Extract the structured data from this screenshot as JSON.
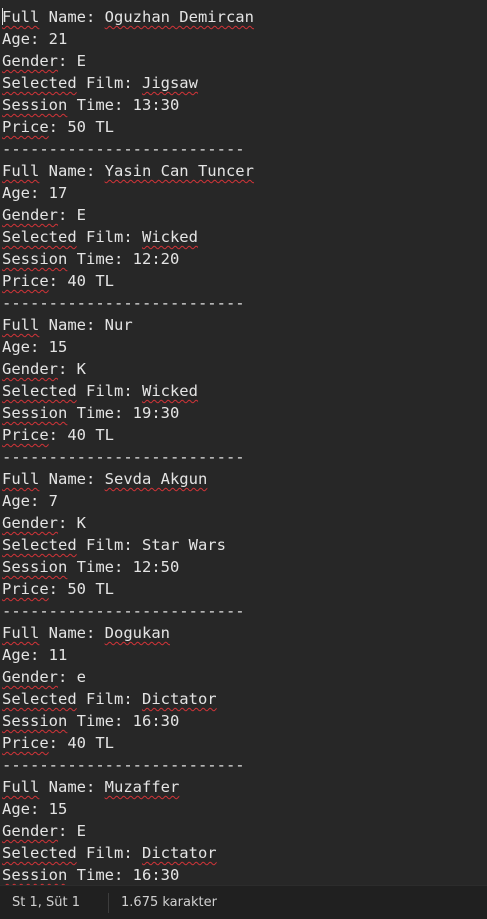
{
  "editor": {
    "lines": [
      {
        "key": "Full",
        "rest": " Name: ",
        "value": "Oguzhan Demircan"
      },
      {
        "key": "Age",
        "rest": ": ",
        "value": "21"
      },
      {
        "key": "Gender",
        "rest": ": ",
        "value": "E"
      },
      {
        "key": "Selected",
        "rest": " Film: ",
        "value": "Jigsaw"
      },
      {
        "key": "Session",
        "rest": " Time: ",
        "value": "13:30"
      },
      {
        "key": "Price",
        "rest": ": ",
        "value": "50 TL"
      },
      {
        "divider": "--------------------------"
      },
      {
        "key": "Full",
        "rest": " Name: ",
        "value": "Yasin Can Tuncer"
      },
      {
        "key": "Age",
        "rest": ": ",
        "value": "17"
      },
      {
        "key": "Gender",
        "rest": ": ",
        "value": "E"
      },
      {
        "key": "Selected",
        "rest": " Film: ",
        "value": "Wicked"
      },
      {
        "key": "Session",
        "rest": " Time: ",
        "value": "12:20"
      },
      {
        "key": "Price",
        "rest": ": ",
        "value": "40 TL"
      },
      {
        "divider": "--------------------------"
      },
      {
        "key": "Full",
        "rest": " Name: ",
        "value": "Nur"
      },
      {
        "key": "Age",
        "rest": ": ",
        "value": "15"
      },
      {
        "key": "Gender",
        "rest": ": ",
        "value": "K"
      },
      {
        "key": "Selected",
        "rest": " Film: ",
        "value": "Wicked"
      },
      {
        "key": "Session",
        "rest": " Time: ",
        "value": "19:30"
      },
      {
        "key": "Price",
        "rest": ": ",
        "value": "40 TL"
      },
      {
        "divider": "--------------------------"
      },
      {
        "key": "Full",
        "rest": " Name: ",
        "value": "Sevda Akgun"
      },
      {
        "key": "Age",
        "rest": ": ",
        "value": "7"
      },
      {
        "key": "Gender",
        "rest": ": ",
        "value": "K"
      },
      {
        "key": "Selected",
        "rest": " Film: ",
        "value": "Star Wars"
      },
      {
        "key": "Session",
        "rest": " Time: ",
        "value": "12:50"
      },
      {
        "key": "Price",
        "rest": ": ",
        "value": "50 TL"
      },
      {
        "divider": "--------------------------"
      },
      {
        "key": "Full",
        "rest": " Name: ",
        "value": "Dogukan"
      },
      {
        "key": "Age",
        "rest": ": ",
        "value": "11"
      },
      {
        "key": "Gender",
        "rest": ": ",
        "value": "e"
      },
      {
        "key": "Selected",
        "rest": " Film: ",
        "value": "Dictator"
      },
      {
        "key": "Session",
        "rest": " Time: ",
        "value": "16:30"
      },
      {
        "key": "Price",
        "rest": ": ",
        "value": "40 TL"
      },
      {
        "divider": "--------------------------"
      },
      {
        "key": "Full",
        "rest": " Name: ",
        "value": "Muzaffer"
      },
      {
        "key": "Age",
        "rest": ": ",
        "value": "15"
      },
      {
        "key": "Gender",
        "rest": ": ",
        "value": "E"
      },
      {
        "key": "Selected",
        "rest": " Film: ",
        "value": "Dictator"
      },
      {
        "key": "Session",
        "rest": " Time: ",
        "value": "16:30"
      }
    ],
    "spell_underlined_keys": [
      "Full",
      "Gender",
      "Selected",
      "Session",
      "Price"
    ],
    "spell_underlined_values": [
      "Oguzhan Demircan",
      "Jigsaw",
      "Yasin Can Tuncer",
      "Wicked",
      "Sevda Akgun",
      "Dogukan",
      "Dictator",
      "Muzaffer"
    ]
  },
  "statusbar": {
    "position": "St 1, Süt 1",
    "char_count": "1.675 karakter"
  },
  "colors": {
    "background": "#272727",
    "text": "#e4e4e4",
    "spell_underline": "#d13438",
    "statusbar_bg": "#202020"
  }
}
